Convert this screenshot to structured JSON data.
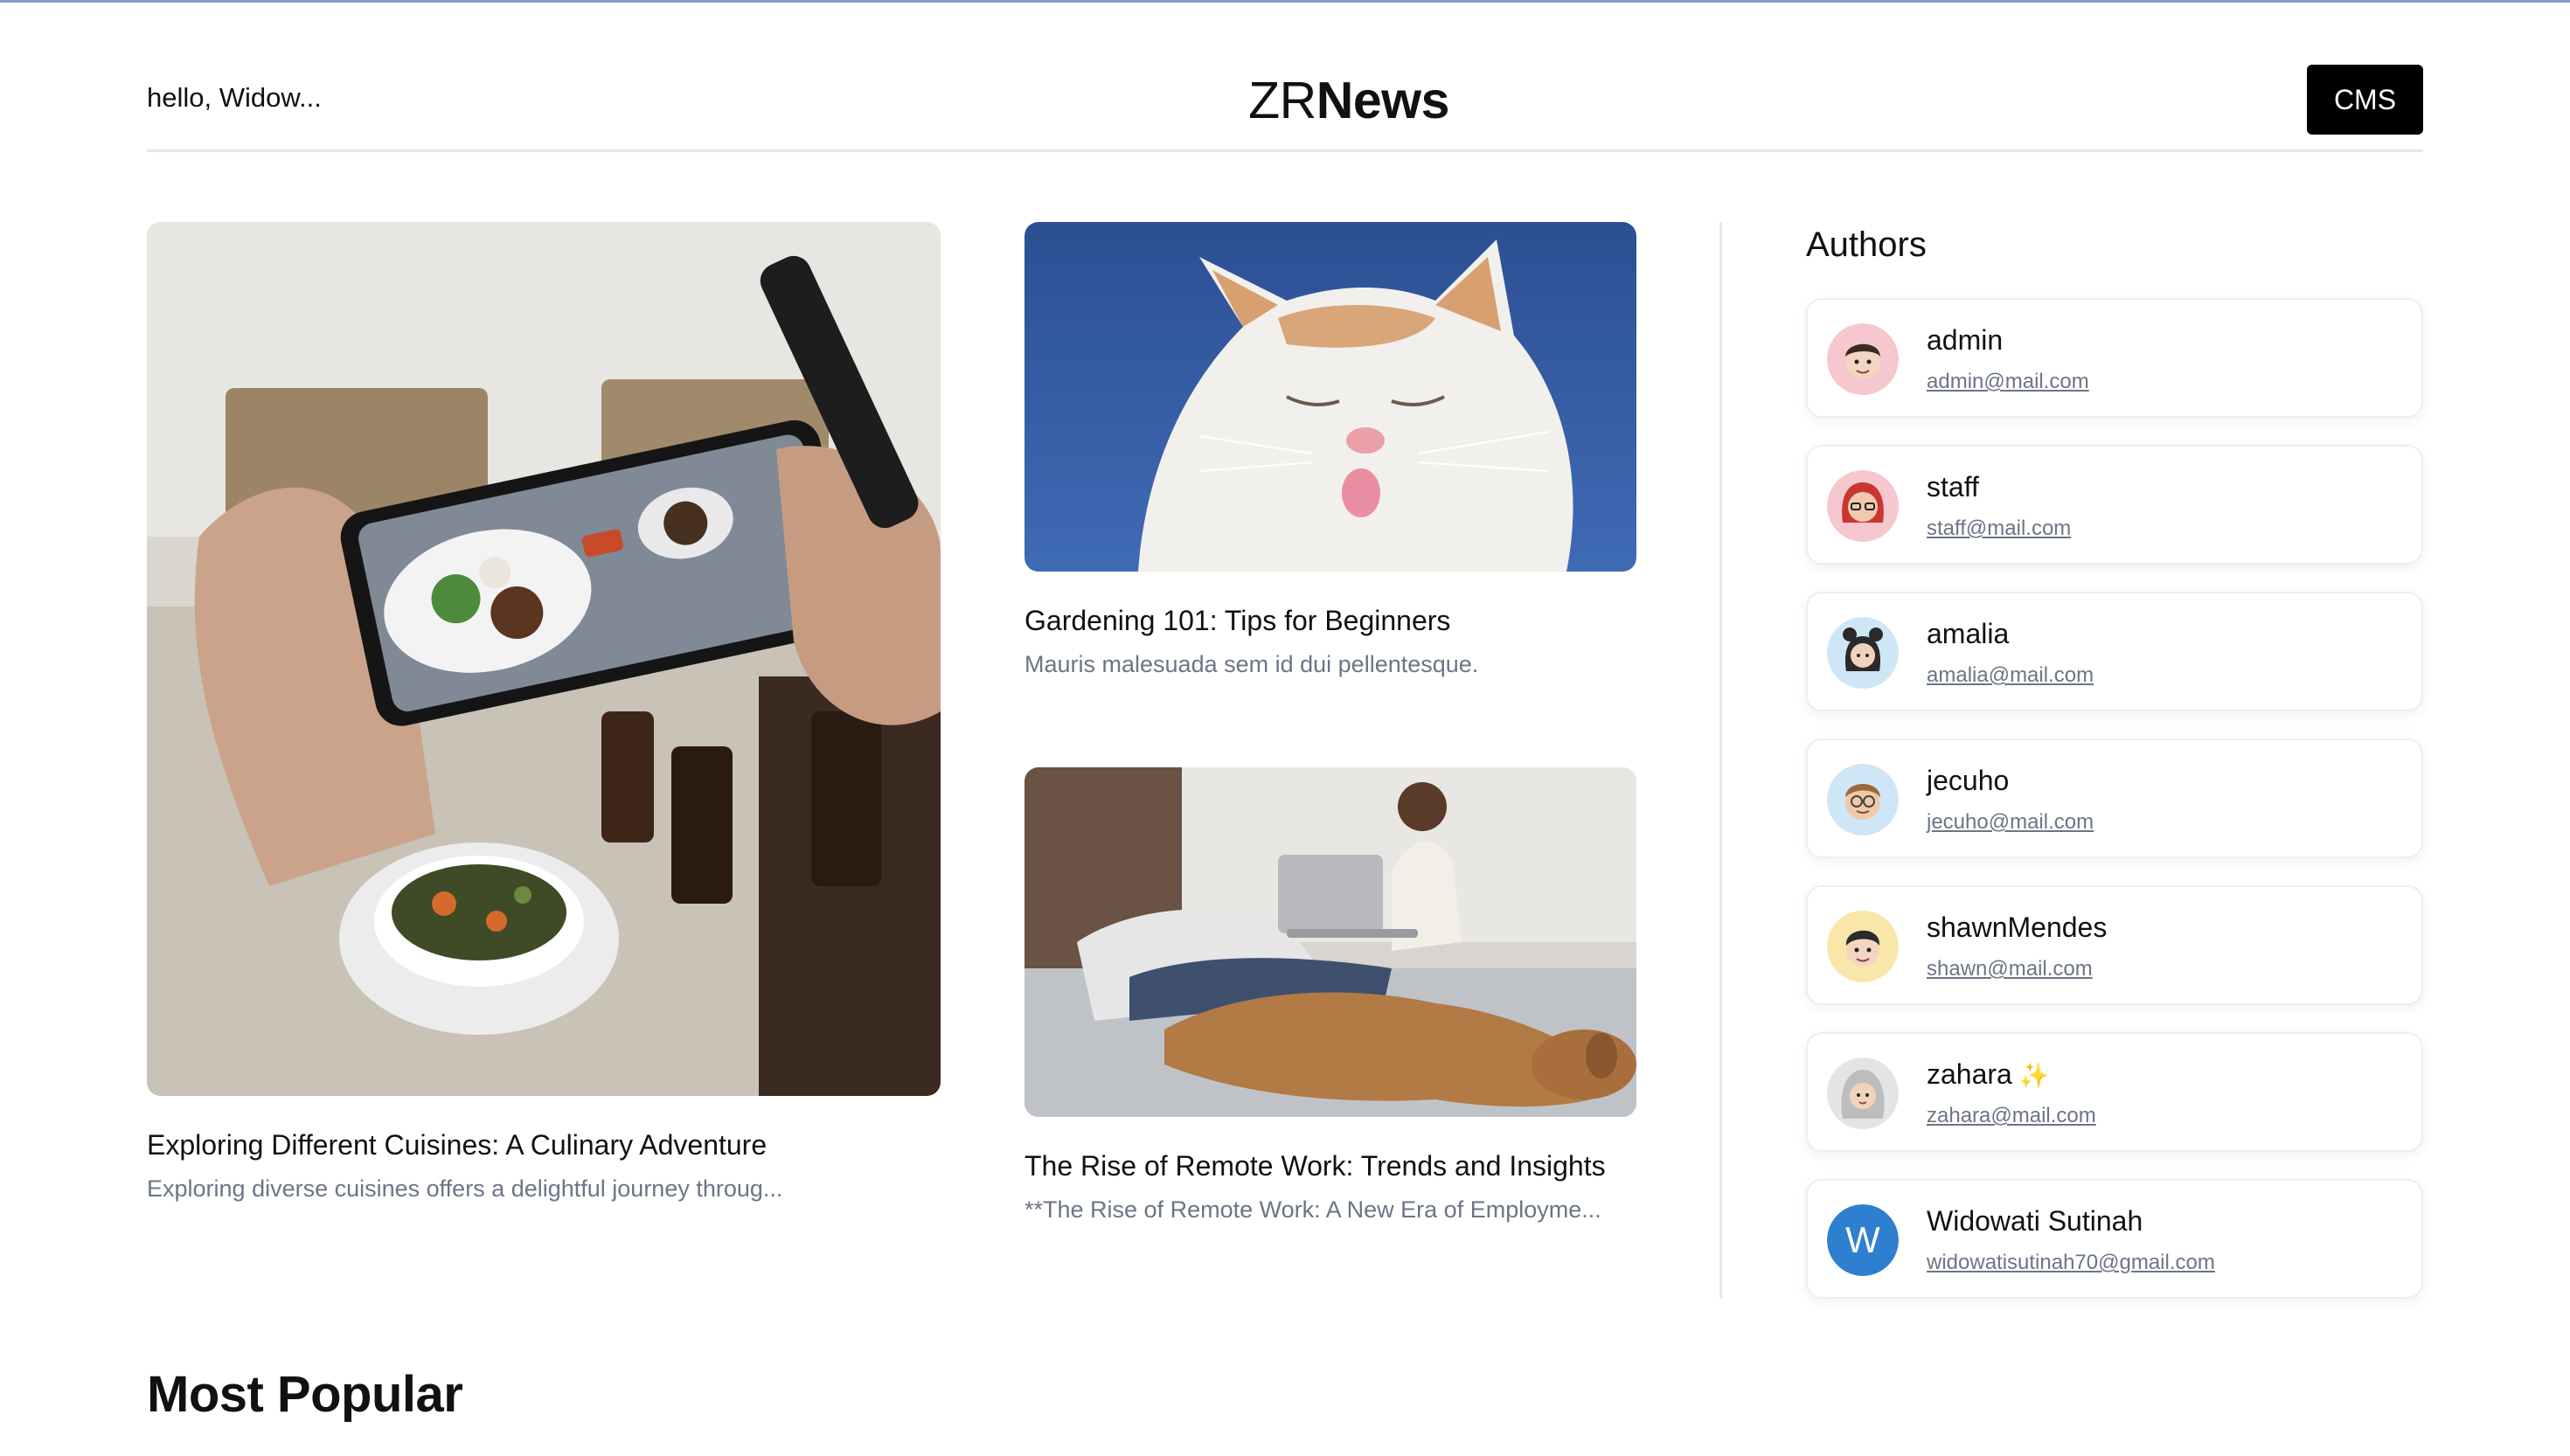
{
  "header": {
    "greeting": "hello, Widow...",
    "logo_light": "ZR",
    "logo_bold": "News",
    "cms_label": "CMS"
  },
  "articles": [
    {
      "title": "Exploring Different Cuisines: A Culinary Adventure",
      "excerpt": "Exploring diverse cuisines offers a delightful journey throug..."
    },
    {
      "title": "Gardening 101: Tips for Beginners",
      "excerpt": "Mauris malesuada sem id dui pellentesque."
    },
    {
      "title": "The Rise of Remote Work: Trends and Insights",
      "excerpt": "**The Rise of Remote Work: A New Era of Employme..."
    }
  ],
  "authors": {
    "heading": "Authors",
    "items": [
      {
        "name": "admin",
        "email": "admin@mail.com",
        "avatar_color": "#f6c7cf"
      },
      {
        "name": "staff",
        "email": "staff@mail.com",
        "avatar_color": "#f6c7cf"
      },
      {
        "name": "amalia",
        "email": "amalia@mail.com",
        "avatar_color": "#cfe6f7"
      },
      {
        "name": "jecuho",
        "email": "jecuho@mail.com",
        "avatar_color": "#cfe6f7"
      },
      {
        "name": "shawnMendes",
        "email": "shawn@mail.com",
        "avatar_color": "#f8e7a8"
      },
      {
        "name": "zahara",
        "email": "zahara@mail.com",
        "avatar_color": "#e4e4e4",
        "badge": "✨"
      },
      {
        "name": "Widowati Sutinah",
        "email": "widowatisutinah70@gmail.com",
        "avatar_letter": "W",
        "avatar_color": "#2f7fd0"
      }
    ]
  },
  "sections": {
    "most_popular": "Most Popular"
  }
}
